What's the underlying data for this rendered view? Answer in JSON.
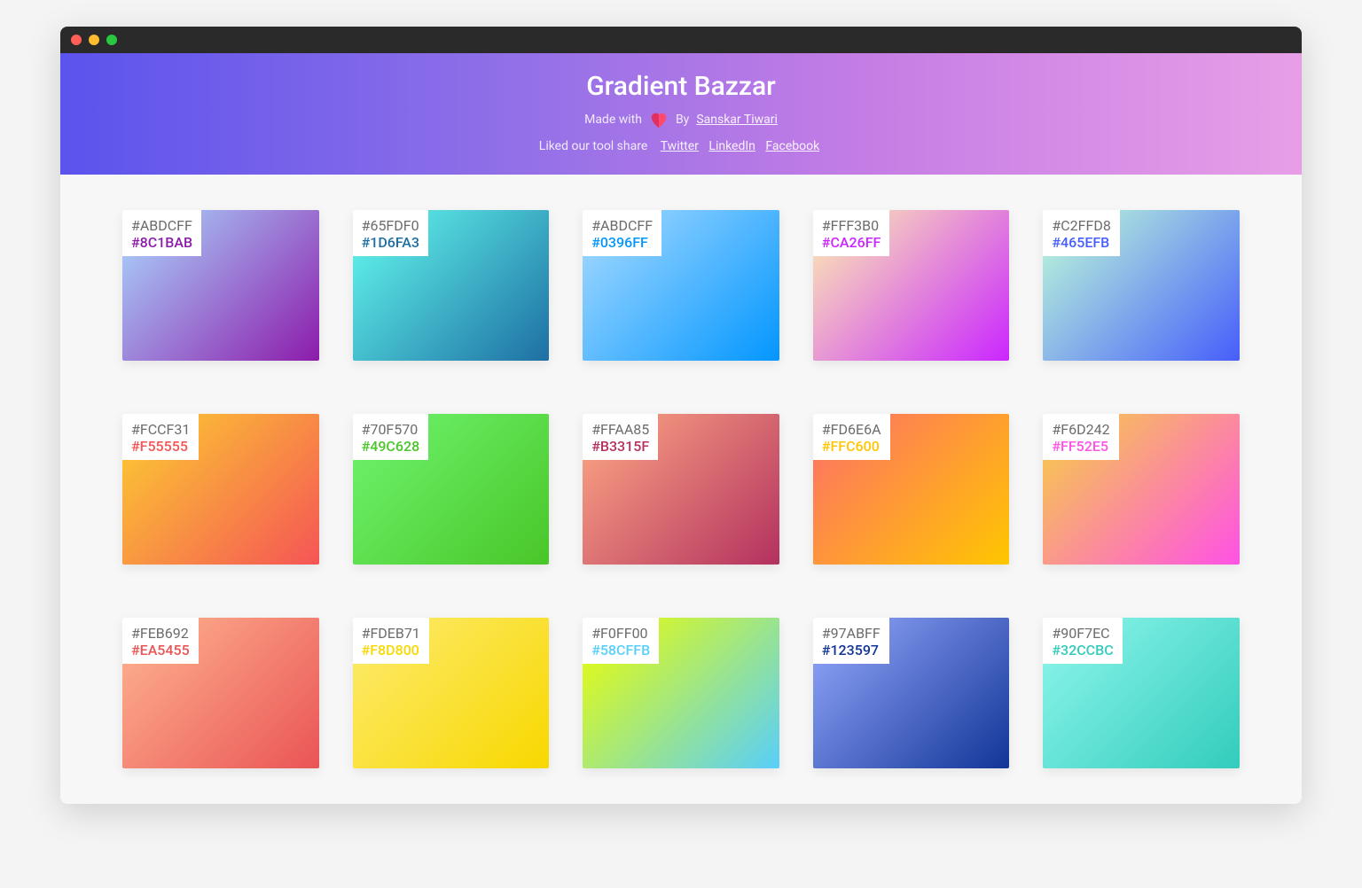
{
  "header": {
    "title": "Gradient Bazzar",
    "made_prefix": "Made with",
    "made_by_prefix": "By",
    "author_name": "Sanskar Tiwari",
    "share_prefix": "Liked our tool share",
    "share_links": {
      "twitter": "Twitter",
      "linkedin": "LinkedIn",
      "facebook": "Facebook"
    }
  },
  "gradients": [
    {
      "c1": "#ABDCFF",
      "c2": "#8C1BAB"
    },
    {
      "c1": "#65FDF0",
      "c2": "#1D6FA3"
    },
    {
      "c1": "#ABDCFF",
      "c2": "#0396FF"
    },
    {
      "c1": "#FFF3B0",
      "c2": "#CA26FF"
    },
    {
      "c1": "#C2FFD8",
      "c2": "#465EFB"
    },
    {
      "c1": "#FCCF31",
      "c2": "#F55555"
    },
    {
      "c1": "#70F570",
      "c2": "#49C628"
    },
    {
      "c1": "#FFAA85",
      "c2": "#B3315F"
    },
    {
      "c1": "#FD6E6A",
      "c2": "#FFC600"
    },
    {
      "c1": "#F6D242",
      "c2": "#FF52E5"
    },
    {
      "c1": "#FEB692",
      "c2": "#EA5455"
    },
    {
      "c1": "#FDEB71",
      "c2": "#F8D800"
    },
    {
      "c1": "#F0FF00",
      "c2": "#58CFFB"
    },
    {
      "c1": "#97ABFF",
      "c2": "#123597"
    },
    {
      "c1": "#90F7EC",
      "c2": "#32CCBC"
    }
  ]
}
